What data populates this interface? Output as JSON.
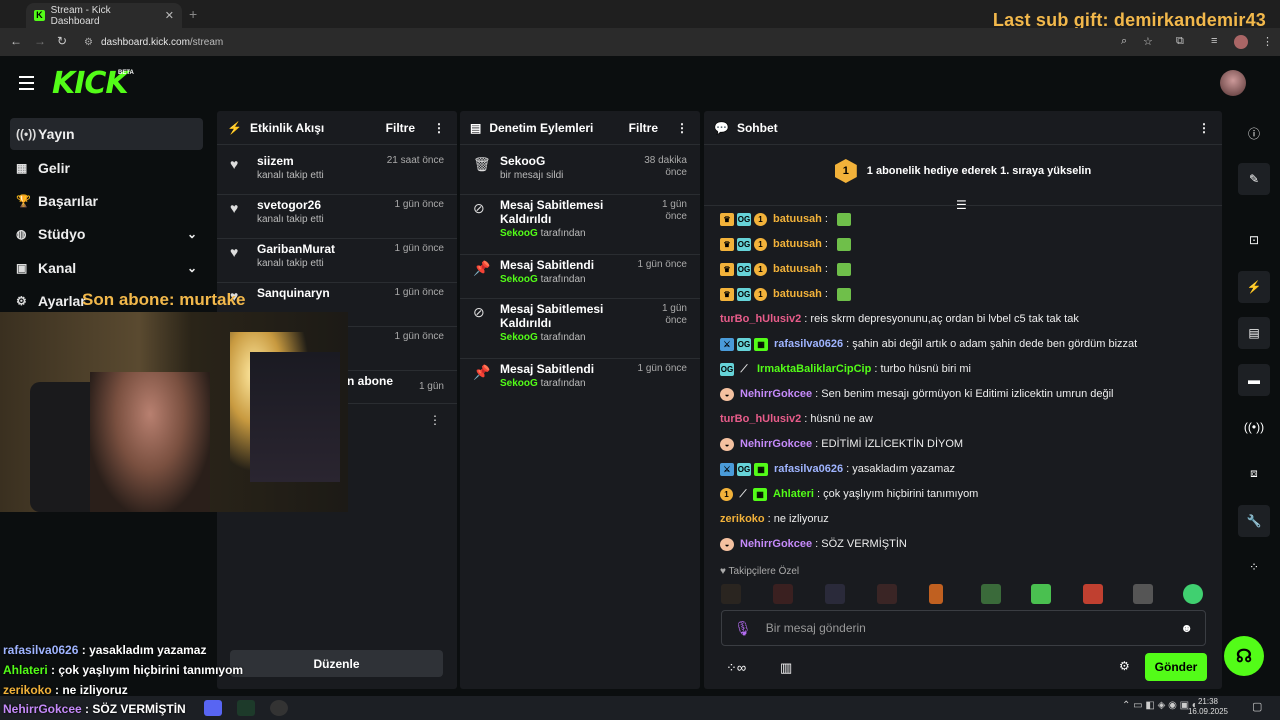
{
  "browser": {
    "tab_title": "Stream - Kick Dashboard",
    "url_host": "dashboard.kick.com",
    "url_path": "/stream"
  },
  "overlay": {
    "gift_banner": "Last sub gift: demirkandemir43",
    "last_sub": "Son abone: murtake",
    "chat": [
      {
        "user": "rafasilva0626",
        "text": " : yasakladım yazamaz",
        "color": "#9fb4ff"
      },
      {
        "user": "Ahlateri",
        "text": " : çok yaşlıyım hiçbirini tanımıyom",
        "color": "#53fc18"
      },
      {
        "user": "zerikoko",
        "text": " : ne izliyoruz",
        "color": "#f2b23a"
      },
      {
        "user": "NehirrGokcee",
        "text": " : SÖZ VERMİŞTİN",
        "color": "#c58af9"
      }
    ]
  },
  "header": {
    "logo": "KICK",
    "beta": "BETA"
  },
  "sidebar": {
    "items": [
      {
        "label": "Yayın",
        "icon": "broadcast-icon"
      },
      {
        "label": "Gelir",
        "icon": "chart-icon"
      },
      {
        "label": "Başarılar",
        "icon": "trophy-icon"
      },
      {
        "label": "Stüdyo",
        "icon": "palette-icon"
      },
      {
        "label": "Kanal",
        "icon": "user-icon"
      },
      {
        "label": "Ayarlar",
        "icon": "gear-icon"
      }
    ]
  },
  "activity": {
    "title": "Etkinlik Akışı",
    "filter": "Filtre",
    "edit": "Düzenle",
    "events": [
      {
        "name": "siizem",
        "desc": "kanalı takip etti",
        "time": "21 saat önce"
      },
      {
        "name": "svetogor26",
        "desc": "kanalı takip etti",
        "time": "1 gün önce"
      },
      {
        "name": "GaribanMurat",
        "desc": "kanalı takip etti",
        "time": "1 gün önce"
      },
      {
        "name": "Sanquinaryn",
        "desc": "",
        "time": "1 gün önce"
      },
      {
        "name": "",
        "desc": "",
        "time": "1 gün önce"
      },
      {
        "name": "n abone",
        "desc": "",
        "time": "1 gün"
      }
    ]
  },
  "moderation": {
    "title": "Denetim Eylemleri",
    "filter": "Filtre",
    "events": [
      {
        "title": "SekooG",
        "by": "",
        "desc": "bir mesajı sildi",
        "time": "38 dakika önce"
      },
      {
        "title": "Mesaj Sabitlemesi Kaldırıldı",
        "by": "SekooG",
        "desc": " tarafından",
        "time": "1 gün önce"
      },
      {
        "title": "Mesaj Sabitlendi",
        "by": "SekooG",
        "desc": " tarafından",
        "time": "1 gün önce"
      },
      {
        "title": "Mesaj Sabitlemesi Kaldırıldı",
        "by": "SekooG",
        "desc": " tarafından",
        "time": "1 gün önce"
      },
      {
        "title": "Mesaj Sabitlendi",
        "by": "SekooG",
        "desc": " tarafından",
        "time": "1 gün önce"
      }
    ]
  },
  "chat": {
    "title": "Sohbet",
    "gift_badge": "1",
    "gift_text": "1 abonelik hediye ederek 1. sıraya yükselin",
    "followers_only": "Takipçilere Özel",
    "input_placeholder": "Bir mesaj gönderin",
    "send": "Gönder",
    "messages": [
      {
        "user": "batuusah",
        "text": "",
        "color": "#f2b23a",
        "badges": [
          "crown",
          "og",
          "sub"
        ],
        "emote": true
      },
      {
        "user": "batuusah",
        "text": "",
        "color": "#f2b23a",
        "badges": [
          "crown",
          "og",
          "sub"
        ],
        "emote": true
      },
      {
        "user": "batuusah",
        "text": "",
        "color": "#f2b23a",
        "badges": [
          "crown",
          "og",
          "sub"
        ],
        "emote": true
      },
      {
        "user": "batuusah",
        "text": "",
        "color": "#f2b23a",
        "badges": [
          "crown",
          "og",
          "sub"
        ],
        "emote": true
      },
      {
        "user": "turBo_hUlusiv2",
        "text": ": reis skrm depresyonunu,aç ordan bi lvbel c5 tak tak tak",
        "color": "#e85c8a",
        "badges": [],
        "emote": false
      },
      {
        "user": "rafasilva0626",
        "text": ": şahin abi değil artık o adam şahin dede ben gördüm bizzat",
        "color": "#9fb4ff",
        "badges": [
          "mod",
          "og",
          "gift"
        ],
        "emote": false
      },
      {
        "user": "IrmaktaBaliklarCipCip",
        "text": ": turbo hüsnü biri mi",
        "color": "#53fc18",
        "badges": [
          "og",
          "sword"
        ],
        "emote": false
      },
      {
        "user": "NehirrGokcee",
        "text": ": Sen benim mesajı görmüyon ki Editimi izlicektin umrun değil",
        "color": "#c58af9",
        "badges": [
          "vip"
        ],
        "emote": false
      },
      {
        "user": "turBo_hUlusiv2",
        "text": ": hüsnü ne aw",
        "color": "#e85c8a",
        "badges": [],
        "emote": false
      },
      {
        "user": "NehirrGokcee",
        "text": ": EDİTİMİ İZLİCEKTİN DİYOM",
        "color": "#c58af9",
        "badges": [
          "vip"
        ],
        "emote": false
      },
      {
        "user": "rafasilva0626",
        "text": ": yasakladım yazamaz",
        "color": "#9fb4ff",
        "badges": [
          "mod",
          "og",
          "gift"
        ],
        "emote": false
      },
      {
        "user": "Ahlateri",
        "text": ": çok yaşlıyım hiçbirini tanımıyom",
        "color": "#53fc18",
        "badges": [
          "sub",
          "sword",
          "gift"
        ],
        "emote": false
      },
      {
        "user": "zerikoko",
        "text": ": ne izliyoruz",
        "color": "#f2b23a",
        "badges": [],
        "emote": false
      },
      {
        "user": "NehirrGokcee",
        "text": ": SÖZ VERMİŞTİN",
        "color": "#c58af9",
        "badges": [
          "vip"
        ],
        "emote": false
      }
    ]
  },
  "taskbar": {
    "time": "21:38",
    "date": "16.09.2025"
  },
  "colors": {
    "accent": "#53fc18",
    "panel": "#191b1f",
    "bg": "#0b0e0f"
  }
}
